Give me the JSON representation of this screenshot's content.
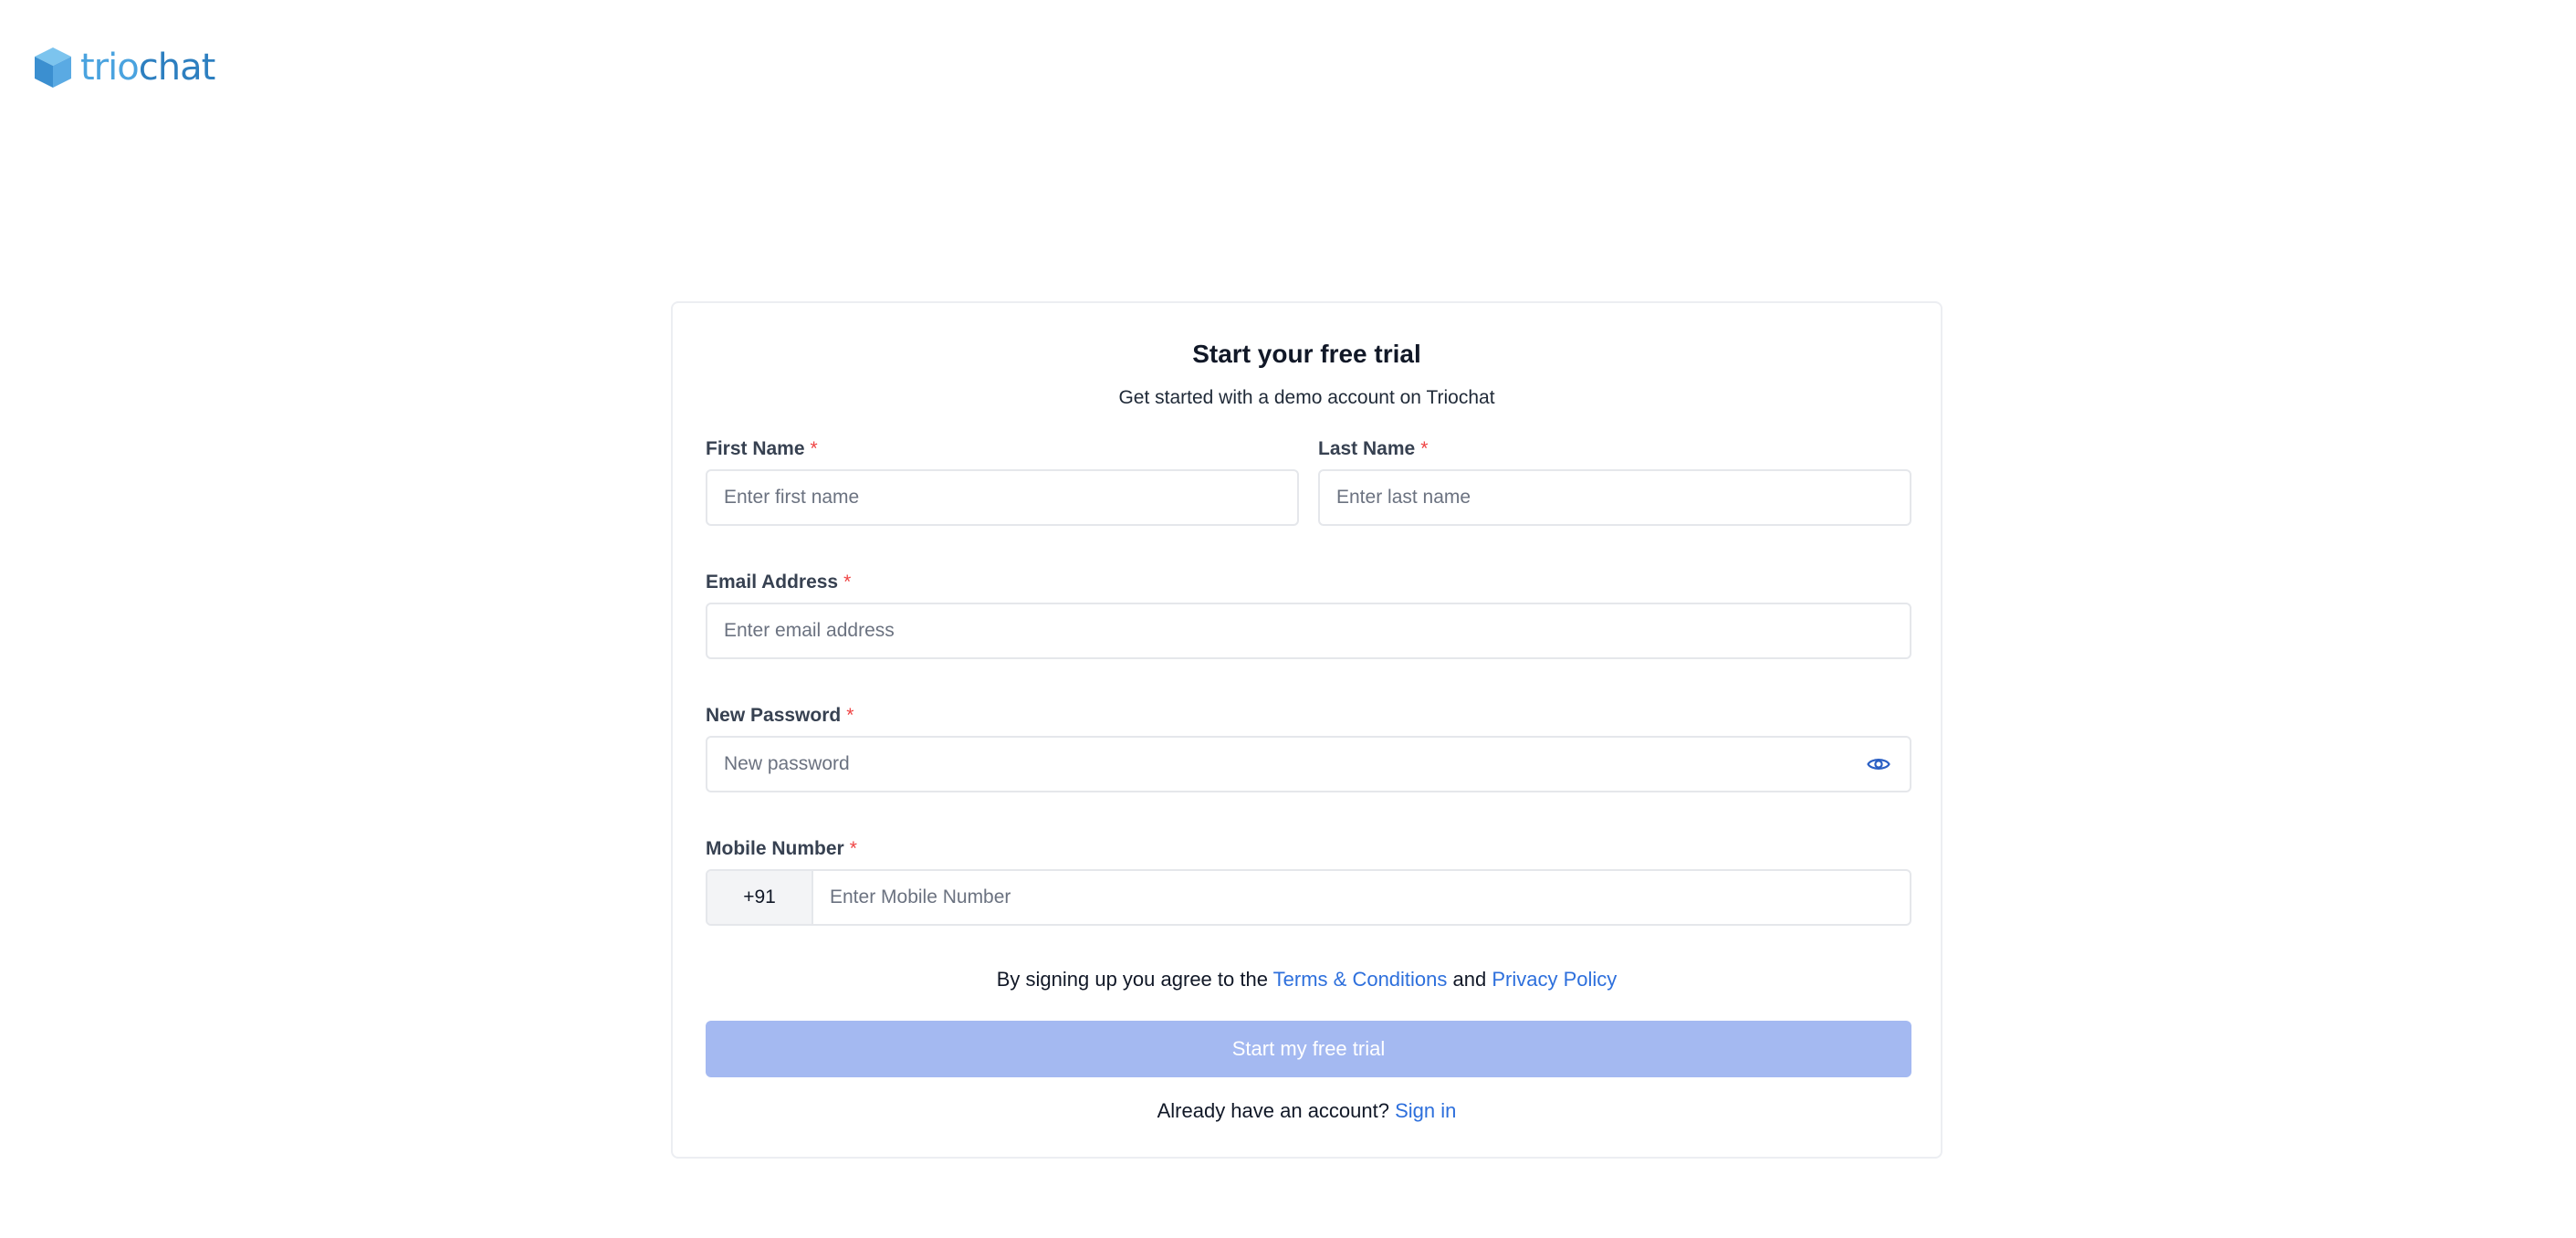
{
  "brand": {
    "logo_text_a": "trio",
    "logo_text_b": "chat"
  },
  "form": {
    "title": "Start your free trial",
    "subtitle": "Get started with a demo account on Triochat",
    "required_mark": "*",
    "first_name": {
      "label": "First Name",
      "placeholder": "Enter first name",
      "value": ""
    },
    "last_name": {
      "label": "Last Name",
      "placeholder": "Enter last name",
      "value": ""
    },
    "email": {
      "label": "Email Address",
      "placeholder": "Enter email address",
      "value": ""
    },
    "password": {
      "label": "New Password",
      "placeholder": "New password",
      "value": "",
      "toggle_icon": "eye-icon"
    },
    "mobile": {
      "label": "Mobile Number",
      "country_code": "+91",
      "placeholder": "Enter Mobile Number",
      "value": ""
    },
    "terms": {
      "prefix": "By signing up you agree to the ",
      "terms_link": "Terms & Conditions",
      "joiner": " and ",
      "privacy_link": "Privacy Policy"
    },
    "submit_label": "Start my free trial",
    "submit_disabled": true,
    "signin": {
      "prompt": "Already have an account? ",
      "link": "Sign in"
    }
  },
  "colors": {
    "accent": "#2d6fdc",
    "button_disabled": "#a4b9f1",
    "required": "#ef4444",
    "logo_light": "#4aa3df",
    "logo_dark": "#2d7fc0"
  }
}
